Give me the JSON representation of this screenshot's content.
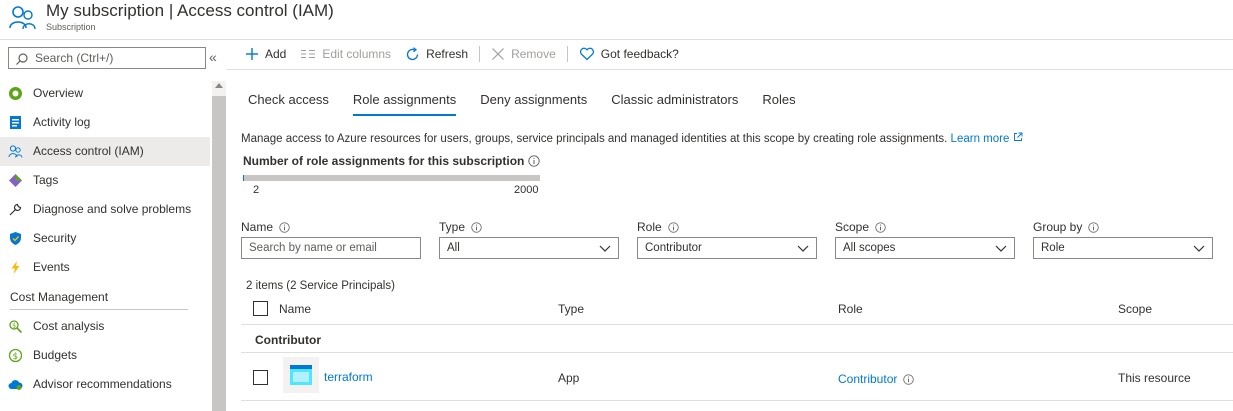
{
  "header": {
    "title": "My subscription | Access control (IAM)",
    "subtitle": "Subscription"
  },
  "sidebar": {
    "search_placeholder": "Search (Ctrl+/)",
    "collapse_glyph": "«",
    "items": [
      {
        "label": "Overview",
        "icon": "overview-icon"
      },
      {
        "label": "Activity log",
        "icon": "activity-log-icon"
      },
      {
        "label": "Access control (IAM)",
        "icon": "users-icon",
        "active": true
      },
      {
        "label": "Tags",
        "icon": "tag-icon"
      },
      {
        "label": "Diagnose and solve problems",
        "icon": "wrench-icon"
      },
      {
        "label": "Security",
        "icon": "shield-icon"
      },
      {
        "label": "Events",
        "icon": "lightning-icon"
      }
    ],
    "section": "Cost Management",
    "section_items": [
      {
        "label": "Cost analysis",
        "icon": "cost-analysis-icon"
      },
      {
        "label": "Budgets",
        "icon": "budget-icon"
      },
      {
        "label": "Advisor recommendations",
        "icon": "cloud-advisor-icon"
      }
    ]
  },
  "toolbar": {
    "add": "Add",
    "edit_columns": "Edit columns",
    "refresh": "Refresh",
    "remove": "Remove",
    "feedback": "Got feedback?"
  },
  "tabs": [
    "Check access",
    "Role assignments",
    "Deny assignments",
    "Classic administrators",
    "Roles"
  ],
  "active_tab": "Role assignments",
  "description": {
    "text": "Manage access to Azure resources for users, groups, service principals and managed identities at this scope by creating role assignments.",
    "link": "Learn more"
  },
  "assignment_count": {
    "title": "Number of role assignments for this subscription",
    "current": "2",
    "max": "2000",
    "fraction": 0.001
  },
  "filters": {
    "name": {
      "label": "Name",
      "placeholder": "Search by name or email"
    },
    "type": {
      "label": "Type",
      "value": "All"
    },
    "role": {
      "label": "Role",
      "value": "Contributor"
    },
    "scope": {
      "label": "Scope",
      "value": "All scopes"
    },
    "group_by": {
      "label": "Group by",
      "value": "Role"
    }
  },
  "table": {
    "summary": "2 items (2 Service Principals)",
    "columns": {
      "name": "Name",
      "type": "Type",
      "role": "Role",
      "scope": "Scope"
    },
    "group": "Contributor",
    "rows": [
      {
        "name": "terraform",
        "type": "App",
        "role": "Contributor",
        "scope": "This resource"
      }
    ]
  },
  "colors": {
    "accent": "#0078d4",
    "text": "#323130",
    "selected_bg": "#edebe9"
  }
}
